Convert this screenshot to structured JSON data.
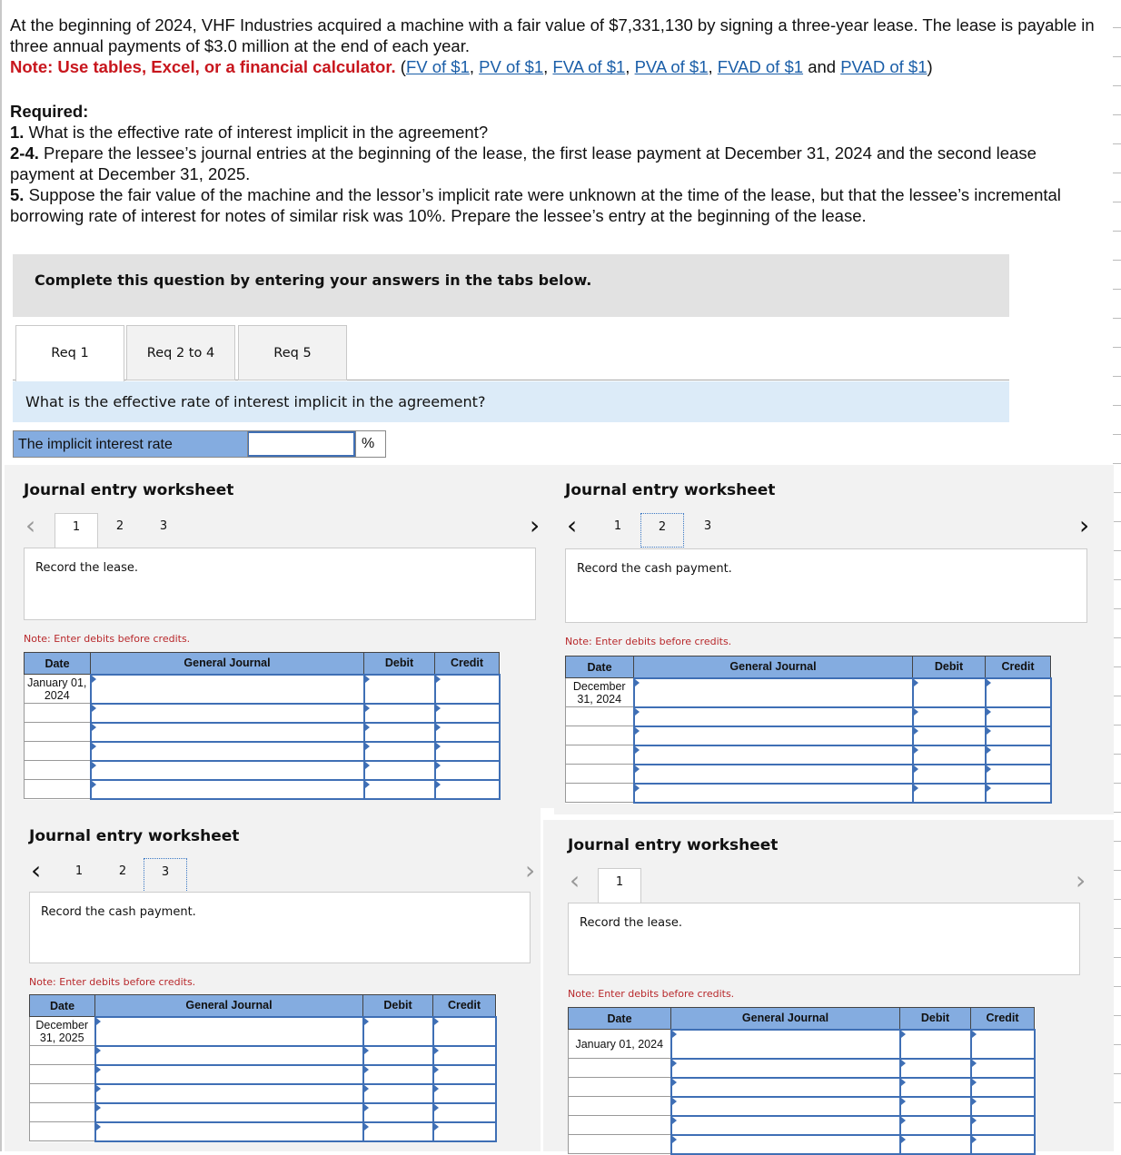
{
  "question": {
    "text": "At the beginning of 2024, VHF Industries acquired a machine with a fair value of $7,331,130 by signing a three-year lease. The lease is payable in three annual payments of $3.0 million at the end of each year.",
    "note_label": "Note: Use tables, Excel, or a financial calculator.",
    "links": [
      "FV of $1",
      "PV of $1",
      "FVA of $1",
      "PVA of $1",
      "FVAD of $1",
      "PVAD of $1"
    ],
    "and_word": "and",
    "required_label": "Required:",
    "requirements": [
      {
        "num": "1.",
        "text": "What is the effective rate of interest implicit in the agreement?"
      },
      {
        "num": "2-4.",
        "text": "Prepare the lessee’s journal entries at the beginning of the lease, the first lease payment at December 31, 2024 and the second lease payment at December 31, 2025."
      },
      {
        "num": "5.",
        "text": "Suppose the fair value of the machine and the lessor’s implicit rate were unknown at the time of the lease, but that the lessee’s incremental borrowing rate of interest for notes of similar risk was 10%. Prepare the lessee’s entry at the beginning of the lease."
      }
    ]
  },
  "instructions": "Complete this question by entering your answers in the tabs below.",
  "tabs": [
    {
      "label": "Req 1",
      "active": true
    },
    {
      "label": "Req 2 to 4",
      "active": false
    },
    {
      "label": "Req 5",
      "active": false
    }
  ],
  "req1": {
    "prompt": "What is the effective rate of interest implicit in the agreement?",
    "rate_label": "The implicit interest rate",
    "rate_value": "",
    "unit": "%"
  },
  "colors": {
    "accent_blue": "#84ace0",
    "note_red": "#b8282b",
    "link_blue": "#1a5ea8",
    "prompt_bg": "#dcebf8"
  },
  "worksheets": [
    {
      "title": "Journal entry worksheet",
      "pages": [
        "1",
        "2",
        "3"
      ],
      "active_page": 0,
      "focus_page": null,
      "description": "Record the lease.",
      "note": "Note: Enter debits before credits.",
      "headers": [
        "Date",
        "General Journal",
        "Debit",
        "Credit"
      ],
      "date": "January 01, 2024",
      "rows": 6
    },
    {
      "title": "Journal entry worksheet",
      "pages": [
        "1",
        "2",
        "3"
      ],
      "active_page": null,
      "focus_page": 1,
      "description": "Record the cash payment.",
      "note": "Note: Enter debits before credits.",
      "headers": [
        "Date",
        "General Journal",
        "Debit",
        "Credit"
      ],
      "date": "December 31, 2024",
      "rows": 6
    },
    {
      "title": "Journal entry worksheet",
      "pages": [
        "1",
        "2",
        "3"
      ],
      "active_page": null,
      "focus_page": 2,
      "description": "Record the cash payment.",
      "note": "Note: Enter debits before credits.",
      "headers": [
        "Date",
        "General Journal",
        "Debit",
        "Credit"
      ],
      "date": "December 31, 2025",
      "rows": 6
    },
    {
      "title": "Journal entry worksheet",
      "pages": [
        "1"
      ],
      "active_page": 0,
      "focus_page": null,
      "description": "Record the lease.",
      "note": "Note: Enter debits before credits.",
      "headers": [
        "Date",
        "General Journal",
        "Debit",
        "Credit"
      ],
      "date": "January 01, 2024",
      "rows": 6
    }
  ]
}
